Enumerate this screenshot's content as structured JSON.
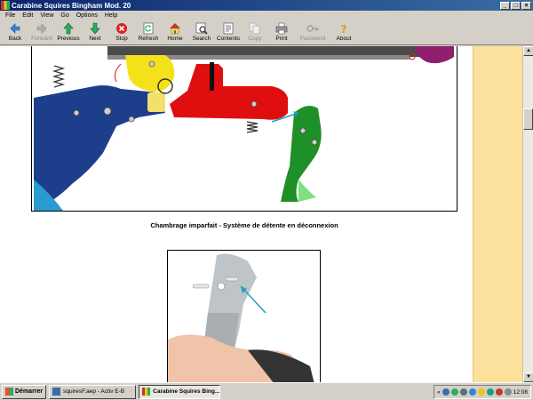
{
  "window": {
    "title": "Carabine Squires Bingham Mod. 20",
    "buttons": [
      "_",
      "□",
      "×"
    ]
  },
  "menu": [
    "File",
    "Edit",
    "View",
    "Go",
    "Options",
    "Help"
  ],
  "toolbar": [
    {
      "label": "Back",
      "icon": "back-arrow-icon",
      "enabled": true
    },
    {
      "label": "Forward",
      "icon": "forward-arrow-icon",
      "enabled": false
    },
    {
      "label": "Previous",
      "icon": "previous-arrow-icon",
      "enabled": true
    },
    {
      "label": "Next",
      "icon": "next-arrow-icon",
      "enabled": true
    },
    {
      "label": "Stop",
      "icon": "stop-icon",
      "enabled": true
    },
    {
      "label": "Refresh",
      "icon": "refresh-icon",
      "enabled": true
    },
    {
      "label": "Home",
      "icon": "home-icon",
      "enabled": true
    },
    {
      "label": "Search",
      "icon": "search-icon",
      "enabled": true
    },
    {
      "label": "Contents",
      "icon": "contents-icon",
      "enabled": true
    },
    {
      "label": "Copy",
      "icon": "copy-icon",
      "enabled": false
    },
    {
      "label": "Print",
      "icon": "print-icon",
      "enabled": true
    },
    {
      "label": "Password",
      "icon": "password-key-icon",
      "enabled": false
    },
    {
      "label": "About",
      "icon": "about-icon",
      "enabled": true
    }
  ],
  "content": {
    "caption": "Chambrage imparfait - Système de détente en déconnexion"
  },
  "taskbar": {
    "start_label": "Démarrer",
    "tasks": [
      {
        "label": "squiresF.aep - Activ E-B",
        "active": false
      },
      {
        "label": "Carabine Squires Bing...",
        "active": true
      }
    ],
    "clock": "12:08",
    "tray_arrows": "«"
  },
  "colors": {
    "title_start": "#0a246a",
    "title_end": "#3a6ea5",
    "sidebar": "#fbe19c",
    "chrome": "#d4d0c8"
  }
}
